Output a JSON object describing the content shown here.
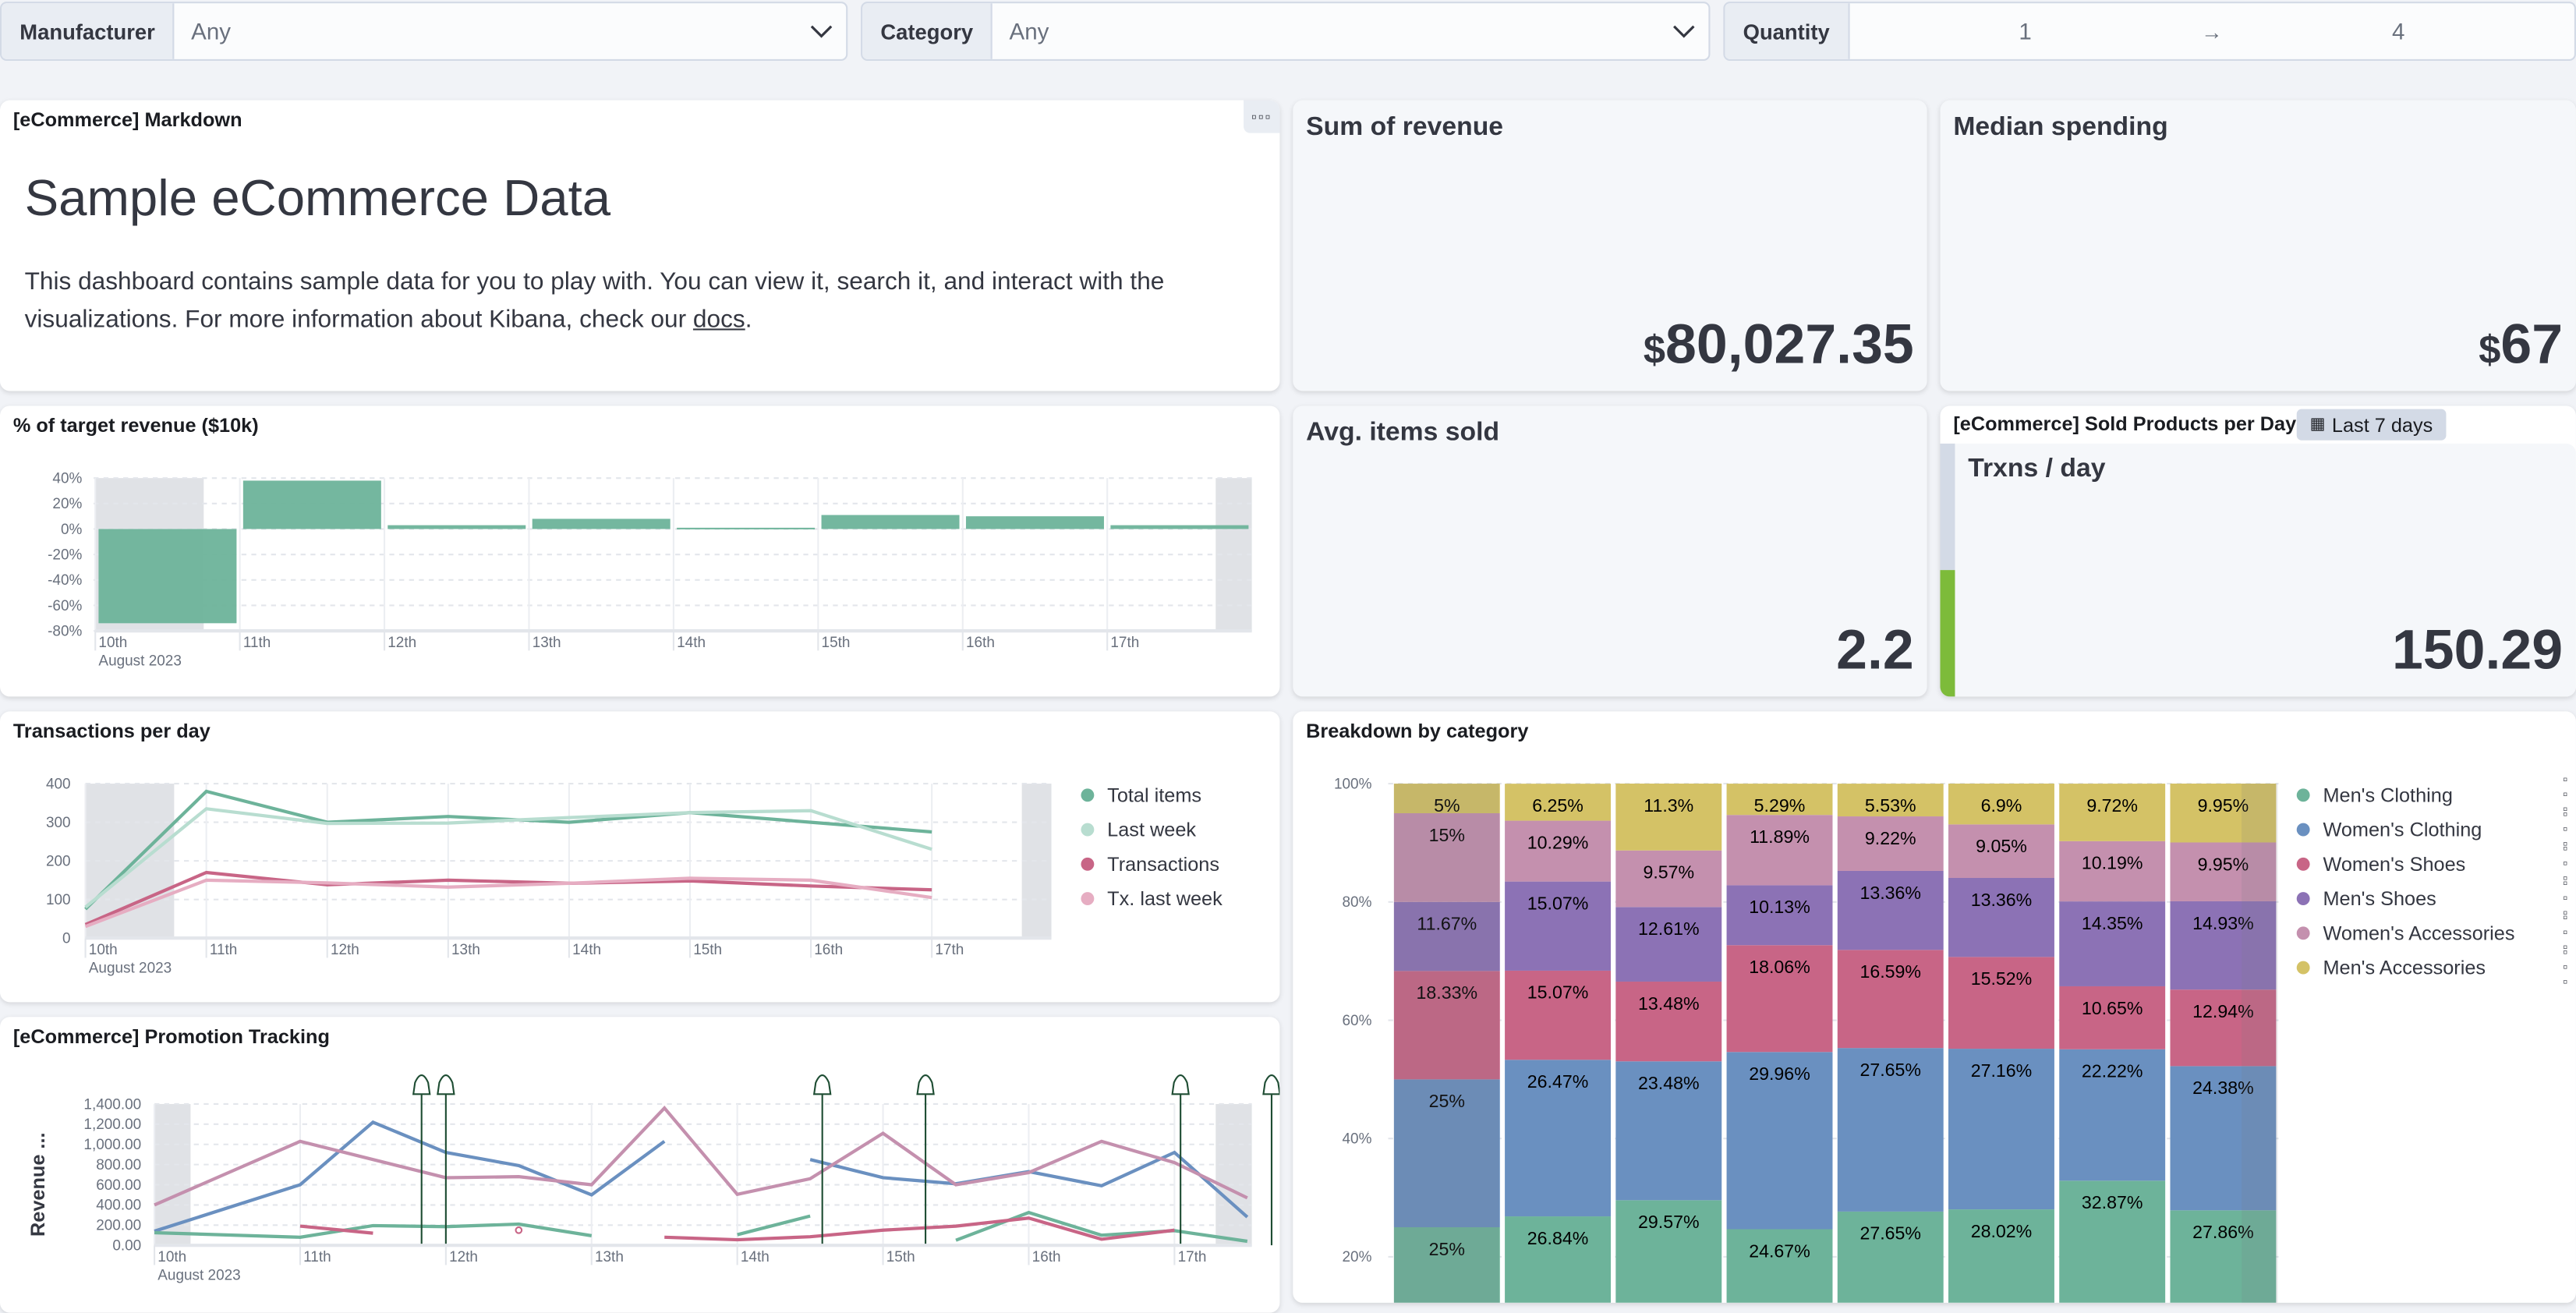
{
  "filters": [
    {
      "label": "Manufacturer",
      "value": "Any"
    },
    {
      "label": "Category",
      "value": "Any"
    },
    {
      "label": "Quantity",
      "min": "1",
      "max": "4"
    }
  ],
  "markdown": {
    "title": "[eCommerce] Markdown",
    "heading": "Sample eCommerce Data",
    "text_before": "This dashboard contains sample data for you to play with. You can view it, search it, and interact with the visualizations. For more information about Kibana, check our ",
    "link": "docs",
    "text_after": "."
  },
  "metrics": {
    "revenue": {
      "title": "Sum of revenue",
      "currency": "$",
      "value": "80,027.35"
    },
    "median": {
      "title": "Median spending",
      "currency": "$",
      "value": "67"
    },
    "avg_items": {
      "title": "Avg. items sold",
      "value": "2.2"
    },
    "sold": {
      "panel_title": "[eCommerce] Sold Products per Day",
      "badge": "Last 7 days",
      "title": "Trxns / day",
      "value": "150.29",
      "progress": 0.5,
      "progress_color": "#7dbb3a"
    }
  },
  "chart_data": [
    {
      "id": "target",
      "type": "bar",
      "title": "% of target revenue ($10k)",
      "categories": [
        "10th",
        "11th",
        "12th",
        "13th",
        "14th",
        "15th",
        "16th",
        "17th"
      ],
      "x_sublabel": "August 2023",
      "values": [
        -74,
        38,
        3,
        8,
        1,
        11,
        10,
        3
      ],
      "ylim": [
        -80,
        40
      ],
      "yticks": [
        "40%",
        "20%",
        "0%",
        "-20%",
        "-40%",
        "-60%",
        "-80%"
      ],
      "color": "#6db39a",
      "grid": true
    },
    {
      "id": "transactions",
      "type": "line",
      "title": "Transactions per day",
      "categories": [
        "10th",
        "11th",
        "12th",
        "13th",
        "14th",
        "15th",
        "16th",
        "17th"
      ],
      "x_sublabel": "August 2023",
      "ylim": [
        0,
        400
      ],
      "yticks": [
        "400",
        "300",
        "200",
        "100",
        "0"
      ],
      "legend": "right",
      "series": [
        {
          "name": "Total items",
          "color": "#6db39a",
          "values": [
            75,
            380,
            300,
            315,
            300,
            325,
            300,
            275
          ]
        },
        {
          "name": "Last week",
          "color": "#b8ddd0",
          "values": [
            80,
            335,
            297,
            298,
            312,
            325,
            330,
            230
          ]
        },
        {
          "name": "Transactions",
          "color": "#c86586",
          "values": [
            35,
            170,
            138,
            150,
            142,
            148,
            135,
            125
          ]
        },
        {
          "name": "Tx. last week",
          "color": "#e6adc2",
          "values": [
            30,
            150,
            143,
            132,
            142,
            155,
            150,
            105
          ]
        }
      ]
    },
    {
      "id": "promotion",
      "type": "line",
      "title": "[eCommerce] Promotion Tracking",
      "ylabel": "Revenue ...",
      "categories": [
        "10th",
        "11th",
        "12th",
        "13th",
        "14th",
        "15th",
        "16th",
        "17th"
      ],
      "x_sublabel": "August 2023",
      "ylim": [
        0,
        1400
      ],
      "yticks": [
        "1,400.00",
        "1,200.00",
        "1,000.00",
        "800.00",
        "600.00",
        "400.00",
        "200.00",
        "0.00"
      ],
      "series": [
        {
          "color": "#6a90c0",
          "points": [
            [
              "2023-08-10T00:00",
              140
            ],
            [
              "2023-08-11T00:00",
              600
            ],
            [
              "2023-08-11T12:00",
              1220
            ],
            [
              "2023-08-12T00:00",
              920
            ],
            [
              "2023-08-12T12:00",
              790
            ],
            [
              "2023-08-13T00:00",
              500
            ],
            [
              "2023-08-13T12:00",
              1030
            ],
            null,
            [
              "2023-08-14T12:00",
              850
            ],
            [
              "2023-08-15T00:00",
              670
            ],
            [
              "2023-08-15T12:00",
              610
            ],
            [
              "2023-08-16T00:00",
              730
            ],
            [
              "2023-08-16T12:00",
              590
            ],
            [
              "2023-08-17T00:00",
              920
            ],
            [
              "2023-08-17T12:00",
              280
            ]
          ]
        },
        {
          "color": "#c490ae",
          "points": [
            [
              "2023-08-10T00:00",
              400
            ],
            [
              "2023-08-11T00:00",
              1030
            ],
            [
              "2023-08-11T12:00",
              850
            ],
            [
              "2023-08-12T00:00",
              670
            ],
            [
              "2023-08-12T12:00",
              680
            ],
            [
              "2023-08-13T00:00",
              600
            ],
            [
              "2023-08-13T12:00",
              1360
            ],
            [
              "2023-08-14T00:00",
              505
            ],
            [
              "2023-08-14T12:00",
              660
            ],
            [
              "2023-08-15T00:00",
              1110
            ],
            [
              "2023-08-15T12:00",
              600
            ],
            [
              "2023-08-16T00:00",
              720
            ],
            [
              "2023-08-16T12:00",
              1030
            ],
            [
              "2023-08-17T00:00",
              820
            ],
            [
              "2023-08-17T12:00",
              470
            ]
          ]
        },
        {
          "color": "#6db39a",
          "points": [
            [
              "2023-08-10T00:00",
              125
            ],
            [
              "2023-08-11T00:00",
              80
            ],
            [
              "2023-08-11T12:00",
              195
            ],
            [
              "2023-08-12T00:00",
              185
            ],
            [
              "2023-08-12T12:00",
              210
            ],
            [
              "2023-08-13T00:00",
              95
            ],
            null,
            [
              "2023-08-14T00:00",
              105
            ],
            [
              "2023-08-14T12:00",
              290
            ],
            null,
            [
              "2023-08-15T12:00",
              50
            ],
            [
              "2023-08-16T00:00",
              325
            ],
            [
              "2023-08-16T12:00",
              100
            ],
            [
              "2023-08-17T00:00",
              145
            ],
            [
              "2023-08-17T12:00",
              40
            ]
          ]
        },
        {
          "color": "#c86586",
          "points": [
            [
              "2023-08-11T00:00",
              190
            ],
            [
              "2023-08-11T12:00",
              120
            ],
            null,
            [
              "2023-08-12T12:00",
              150
            ],
            null,
            [
              "2023-08-13T12:00",
              80
            ],
            [
              "2023-08-14T00:00",
              55
            ],
            [
              "2023-08-14T12:00",
              85
            ],
            [
              "2023-08-15T00:00",
              150
            ],
            [
              "2023-08-15T12:00",
              190
            ],
            [
              "2023-08-16T00:00",
              270
            ],
            [
              "2023-08-16T12:00",
              60
            ],
            [
              "2023-08-17T00:00",
              150
            ]
          ]
        }
      ],
      "annotations": [
        "2023-08-11T20:00",
        "2023-08-12T00:00",
        "2023-08-14T14:00",
        "2023-08-15T07:00",
        "2023-08-17T01:00",
        "2023-08-17T16:00"
      ],
      "annotation_color": "#1e4d33"
    },
    {
      "id": "breakdown",
      "type": "bar",
      "stacked": "percent",
      "title": "Breakdown by category",
      "yticks": [
        "100%",
        "80%",
        "60%",
        "40%",
        "20%"
      ],
      "legend": "right",
      "series": [
        {
          "name": "Men's Clothing",
          "color": "#6db39a",
          "values": [
            25,
            26.84,
            29.57,
            24.67,
            27.65,
            28.02,
            32.87,
            27.86
          ],
          "labels": [
            "25%",
            "26.84%",
            "29.57%",
            "24.67%",
            "27.65%",
            "28.02%",
            "32.87%",
            "27.86%"
          ]
        },
        {
          "name": "Women's Clothing",
          "color": "#6a90c0",
          "values": [
            25,
            26.47,
            23.48,
            29.96,
            27.65,
            27.16,
            22.22,
            24.38
          ],
          "labels": [
            "25%",
            "26.47%",
            "23.48%",
            "29.96%",
            "27.65%",
            "27.16%",
            "22.22%",
            "24.38%"
          ]
        },
        {
          "name": "Women's Shoes",
          "color": "#c86586",
          "values": [
            18.33,
            15.07,
            13.48,
            18.06,
            16.59,
            15.52,
            10.65,
            12.94
          ],
          "labels": [
            "18.33%",
            "15.07%",
            "13.48%",
            "18.06%",
            "16.59%",
            "15.52%",
            "10.65%",
            "12.94%"
          ]
        },
        {
          "name": "Men's Shoes",
          "color": "#8c72b5",
          "values": [
            11.67,
            15.07,
            12.61,
            10.13,
            13.36,
            13.36,
            14.35,
            14.93
          ],
          "labels": [
            "11.67%",
            "15.07%",
            "12.61%",
            "10.13%",
            "13.36%",
            "13.36%",
            "14.35%",
            "14.93%"
          ]
        },
        {
          "name": "Women's Accessories",
          "color": "#c490ae",
          "values": [
            15,
            10.29,
            9.57,
            11.89,
            9.22,
            9.05,
            10.19,
            9.95
          ],
          "labels": [
            "15%",
            "10.29%",
            "9.57%",
            "11.89%",
            "9.22%",
            "9.05%",
            "10.19%",
            "9.95%"
          ]
        },
        {
          "name": "Men's Accessories",
          "color": "#d4c266",
          "values": [
            5,
            6.25,
            11.3,
            5.29,
            5.53,
            6.9,
            9.72,
            9.95
          ],
          "labels": [
            "5%",
            "6.25%",
            "11.3%",
            "5.29%",
            "5.53%",
            "6.9%",
            "9.72%",
            "9.95%"
          ]
        }
      ]
    }
  ]
}
